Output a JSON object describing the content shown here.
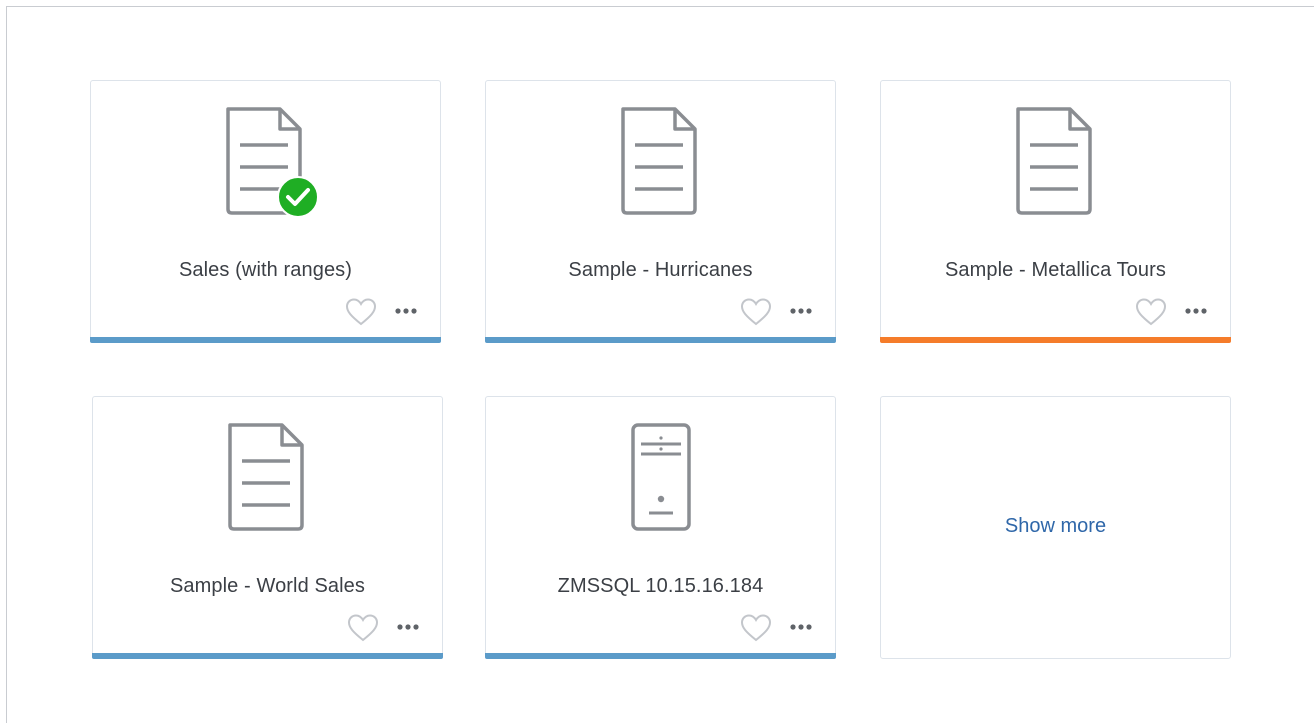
{
  "colors": {
    "bar_blue": "#5b9bc9",
    "bar_orange": "#f57c2a",
    "icon_gray": "#8a8d92",
    "check_green": "#1fae24",
    "link_blue": "#2f67a9"
  },
  "cards": [
    {
      "title": "Sales (with ranges)",
      "icon": "document-icon",
      "badge": "check-badge-icon",
      "bar_color": "blue"
    },
    {
      "title": "Sample - Hurricanes",
      "icon": "document-icon",
      "bar_color": "blue"
    },
    {
      "title": "Sample - Metallica Tours",
      "icon": "document-icon",
      "bar_color": "orange"
    },
    {
      "title": "Sample - World Sales",
      "icon": "document-icon",
      "bar_color": "blue"
    },
    {
      "title": "ZMSSQL 10.15.16.184",
      "icon": "server-icon",
      "bar_color": "blue"
    }
  ],
  "show_more_label": "Show more"
}
